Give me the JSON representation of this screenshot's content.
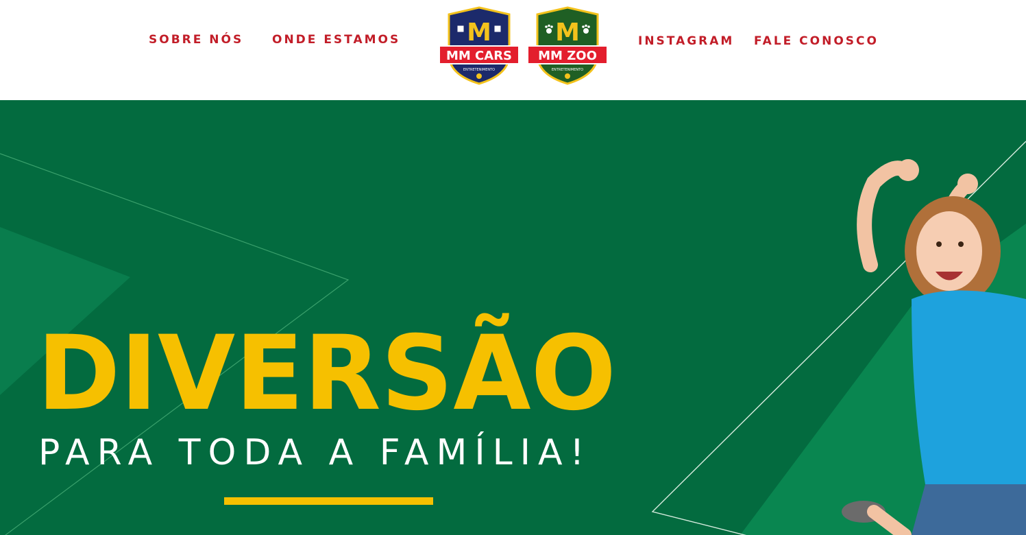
{
  "nav": {
    "about": "SOBRE NÓS",
    "locations": "ONDE ESTAMOS",
    "instagram": "INSTAGRAM",
    "contact": "FALE CONOSCO"
  },
  "logos": {
    "cars": {
      "monogram": "M",
      "name": "MM CARS",
      "tagline": "ENTRETENIMENTO"
    },
    "zoo": {
      "monogram": "M",
      "name": "MM ZOO",
      "tagline": "ENTRETENIMENTO"
    }
  },
  "hero": {
    "headline": "DIVERSÃO",
    "subheadline": "PARA TODA A FAMÍLIA!"
  },
  "colors": {
    "nav_text": "#c21d28",
    "hero_bg": "#036b3f",
    "headline": "#f6c000",
    "subheadline": "#ffffff"
  }
}
